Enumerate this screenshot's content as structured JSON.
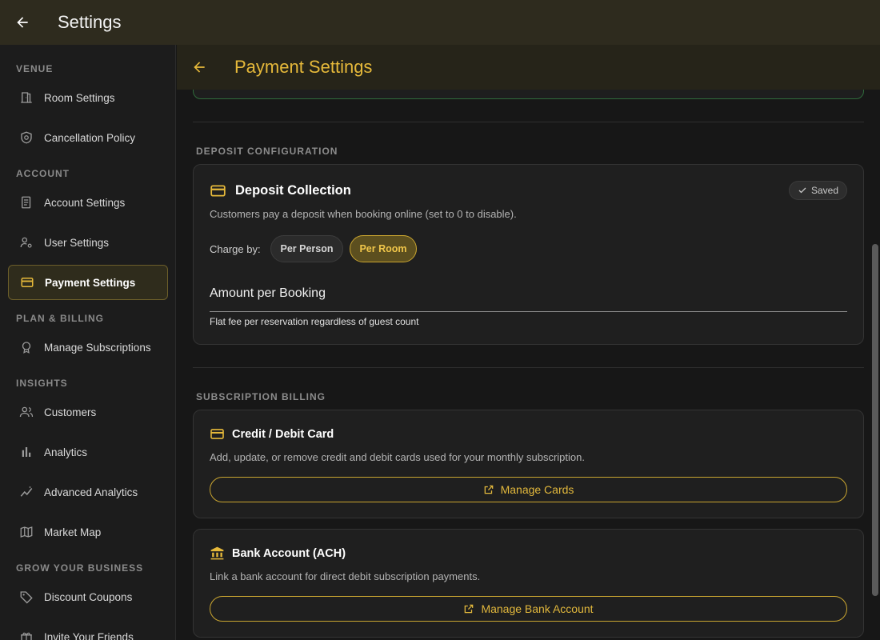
{
  "app": {
    "title": "Settings"
  },
  "sidebar": {
    "sections": {
      "venue": "VENUE",
      "account": "ACCOUNT",
      "plan": "PLAN & BILLING",
      "insights": "INSIGHTS",
      "grow": "GROW YOUR BUSINESS"
    },
    "items": [
      {
        "label": "Room Settings",
        "icon": "door-icon"
      },
      {
        "label": "Cancellation Policy",
        "icon": "shield-icon"
      },
      {
        "label": "Account Settings",
        "icon": "document-icon"
      },
      {
        "label": "User Settings",
        "icon": "user-gear-icon"
      },
      {
        "label": "Payment Settings",
        "icon": "credit-card-icon",
        "active": true
      },
      {
        "label": "Manage Subscriptions",
        "icon": "badge-icon"
      },
      {
        "label": "Customers",
        "icon": "people-icon"
      },
      {
        "label": "Analytics",
        "icon": "bar-chart-icon"
      },
      {
        "label": "Advanced Analytics",
        "icon": "trend-icon"
      },
      {
        "label": "Market Map",
        "icon": "map-icon"
      },
      {
        "label": "Discount Coupons",
        "icon": "tag-icon"
      },
      {
        "label": "Invite Your Friends",
        "icon": "gift-icon"
      }
    ]
  },
  "main": {
    "title": "Payment Settings",
    "deposit": {
      "section_label": "DEPOSIT CONFIGURATION",
      "title": "Deposit Collection",
      "status": "Saved",
      "description": "Customers pay a deposit when booking online (set to 0 to disable).",
      "charge_by_label": "Charge by:",
      "options": [
        "Per Person",
        "Per Room"
      ],
      "selected_option": "Per Room",
      "amount_label": "Amount per Booking",
      "amount_value": "",
      "amount_helper": "Flat fee per reservation regardless of guest count"
    },
    "billing": {
      "section_label": "SUBSCRIPTION BILLING",
      "card": {
        "title": "Credit / Debit Card",
        "description": "Add, update, or remove credit and debit cards used for your monthly subscription.",
        "button": "Manage Cards"
      },
      "bank": {
        "title": "Bank Account (ACH)",
        "description": "Link a bank account for direct debit subscription payments.",
        "button": "Manage Bank Account"
      }
    }
  },
  "colors": {
    "accent": "#e6b93a",
    "topbar": "#2e2b1e",
    "background": "#171717",
    "card": "#1f1f1f"
  }
}
